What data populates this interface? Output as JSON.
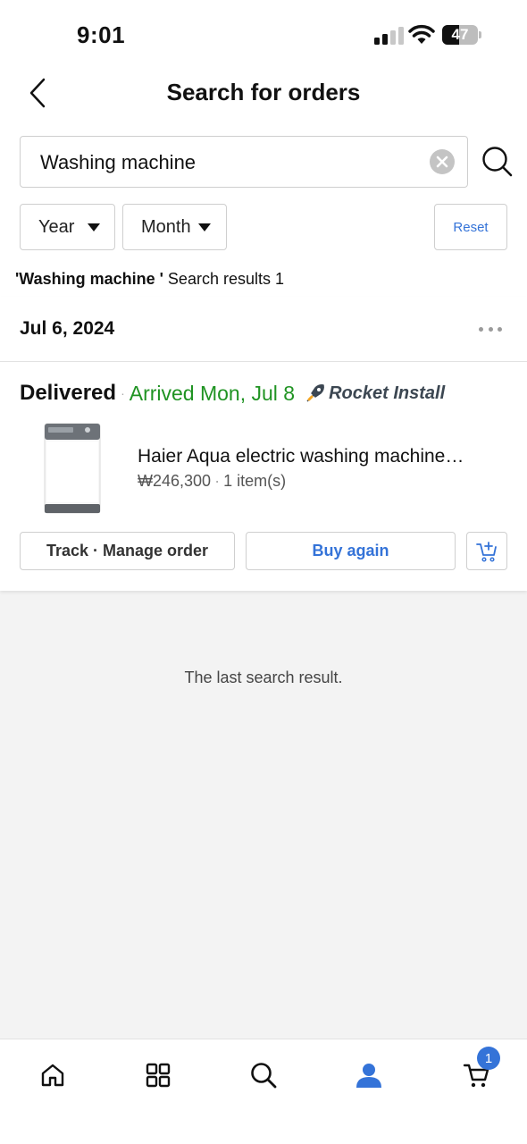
{
  "status_bar": {
    "time": "9:01",
    "battery": "47",
    "battery_level": 0.47
  },
  "header": {
    "title": "Search for orders"
  },
  "search": {
    "value": "Washing machine",
    "placeholder": ""
  },
  "filters": {
    "year_label": "Year",
    "month_label": "Month",
    "reset_label": "Reset"
  },
  "results": {
    "query": "'Washing machine '",
    "count_text": " Search results 1"
  },
  "order": {
    "date": "Jul 6, 2024",
    "status": "Delivered",
    "separator": "·",
    "arrival": "Arrived Mon, Jul 8",
    "badge": "Rocket Install",
    "product_name": "Haier Aqua electric washing machine…",
    "price": "₩246,300",
    "quantity": "1 item(s)",
    "track_label": "Track · Manage order",
    "buy_again_label": "Buy again"
  },
  "footer_text": "The last search result.",
  "nav": {
    "items": [
      "home-icon",
      "categories-icon",
      "search-icon",
      "my-account-icon",
      "cart-icon"
    ],
    "active": "my-account-icon",
    "cart_count": "1"
  },
  "colors": {
    "accent": "#3473d8",
    "arrival_green": "#1f9322",
    "background": "#f3f3f3"
  }
}
